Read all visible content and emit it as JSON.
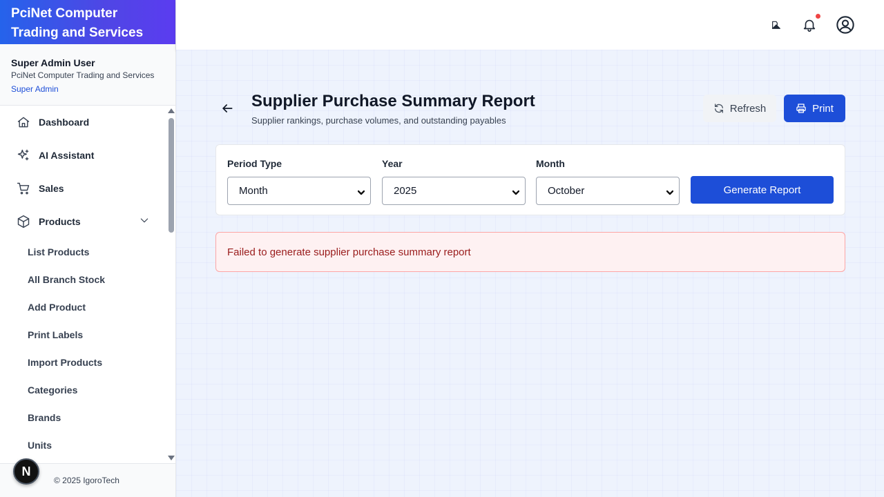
{
  "brand": {
    "line1": "PciNet Computer",
    "line2": "Trading and Services"
  },
  "user": {
    "name": "Super Admin User",
    "company": "PciNet Computer Trading and Services",
    "role": "Super Admin"
  },
  "nav": {
    "items": [
      {
        "label": "Dashboard",
        "icon": "home-icon"
      },
      {
        "label": "AI Assistant",
        "icon": "sparkles-icon"
      },
      {
        "label": "Sales",
        "icon": "cart-icon"
      },
      {
        "label": "Products",
        "icon": "box-icon",
        "expanded": true
      }
    ],
    "sub_items": [
      {
        "label": "List Products"
      },
      {
        "label": "All Branch Stock"
      },
      {
        "label": "Add Product"
      },
      {
        "label": "Print Labels"
      },
      {
        "label": "Import Products"
      },
      {
        "label": "Categories"
      },
      {
        "label": "Brands"
      },
      {
        "label": "Units"
      }
    ]
  },
  "footer": {
    "copyright": "© 2025 IgoroTech",
    "badge": "N"
  },
  "header": {
    "icons": [
      "theme-toggle-icon",
      "bell-icon",
      "user-circle-icon"
    ],
    "has_notification": true
  },
  "page": {
    "title": "Supplier Purchase Summary Report",
    "subtitle": "Supplier rankings, purchase volumes, and outstanding payables",
    "refresh_label": "Refresh",
    "print_label": "Print"
  },
  "filters": {
    "period_type": {
      "label": "Period Type",
      "value": "Month"
    },
    "year": {
      "label": "Year",
      "value": "2025"
    },
    "month": {
      "label": "Month",
      "value": "October"
    },
    "generate_label": "Generate Report"
  },
  "error": {
    "message": "Failed to generate supplier purchase summary report"
  },
  "colors": {
    "primary": "#1d4ed8",
    "brand_gradient_start": "#2563eb",
    "brand_gradient_end": "#5b3cf0",
    "error_bg": "#fef1f2",
    "error_text": "#991b1b"
  }
}
